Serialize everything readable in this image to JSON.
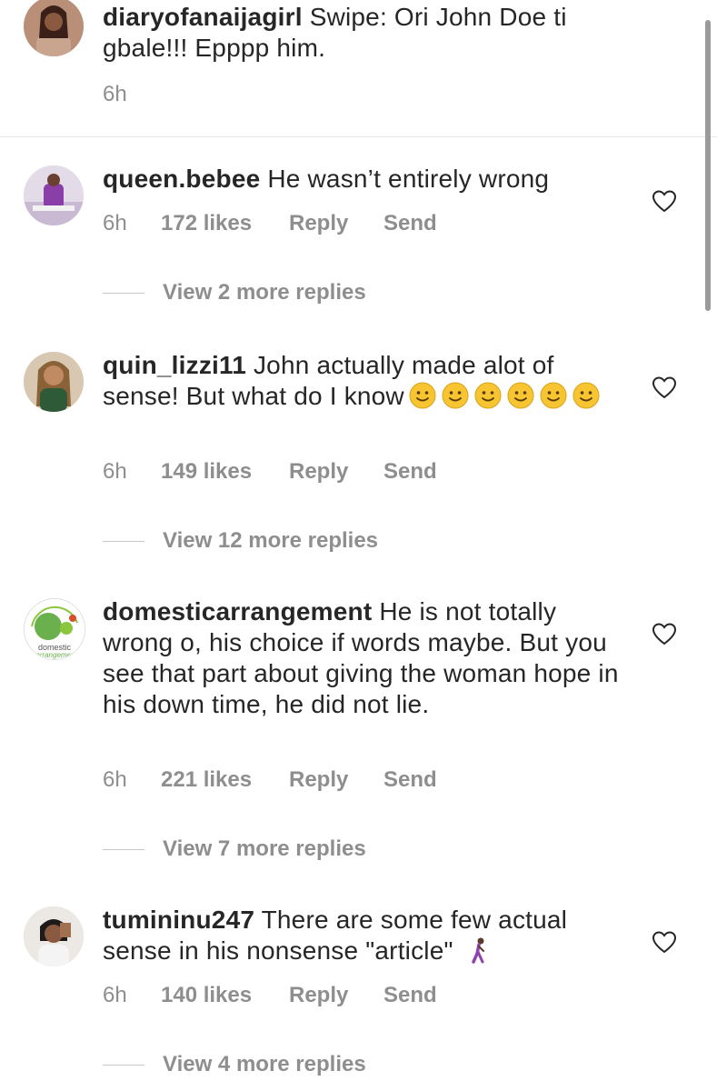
{
  "caption_comment": {
    "username": "diaryofanaijagirl",
    "text": "Swipe: Ori John Doe ti gbale!!! Epppp him.",
    "time": "6h"
  },
  "comments": [
    {
      "username": "queen.bebee",
      "text": "He wasn’t entirely wrong",
      "time": "6h",
      "likes": "172 likes",
      "reply_label": "Reply",
      "send_label": "Send",
      "view_replies": "View 2 more replies"
    },
    {
      "username": "quin_lizzi11",
      "text": "John actually made alot of sense! But what do I know",
      "emoji_count": 6,
      "time": "6h",
      "likes": "149 likes",
      "reply_label": "Reply",
      "send_label": "Send",
      "view_replies": "View 12 more replies"
    },
    {
      "username": "domesticarrangement",
      "text": "He is not totally wrong o, his choice if words maybe. But you see that part about giving the woman hope in his down time, he did not lie.",
      "avatar_text_1": "domestic",
      "avatar_text_2": "arrangement",
      "time": "6h",
      "likes": "221 likes",
      "reply_label": "Reply",
      "send_label": "Send",
      "view_replies": "View 7 more replies"
    },
    {
      "username": "tumininu247",
      "text": "There are some few actual sense in his nonsense \"article\"",
      "time": "6h",
      "likes": "140 likes",
      "reply_label": "Reply",
      "send_label": "Send",
      "view_replies": "View 4 more replies"
    }
  ],
  "icons": {
    "like": "heart-outline-icon",
    "emoji": "slightly-smiling-face-emoji",
    "walking": "person-walking-emoji"
  },
  "colors": {
    "text": "#262626",
    "secondary": "#8e8e8e",
    "divider": "#e6e6e6"
  }
}
